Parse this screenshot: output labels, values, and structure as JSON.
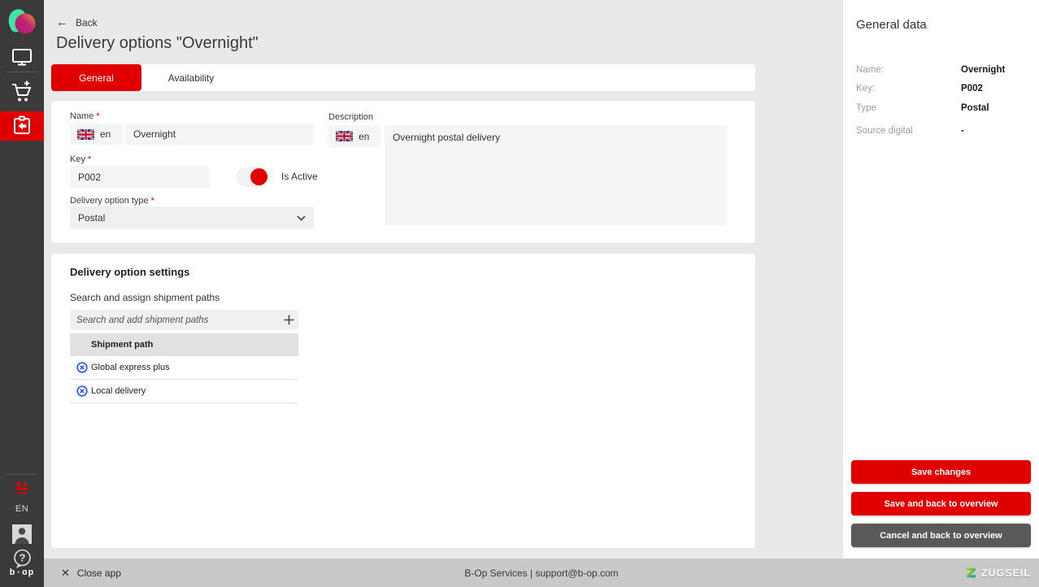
{
  "sidebar": {
    "language_badge": "EN"
  },
  "header": {
    "back_label": "Back",
    "title": "Delivery options \"Overnight\""
  },
  "tabs": {
    "general": "General",
    "availability": "Availability"
  },
  "form": {
    "required_marker": "*",
    "name_label": "Name",
    "name_lang": "en",
    "name_value": "Overnight",
    "key_label": "Key",
    "key_value": "P002",
    "is_active_label": "Is Active",
    "type_label": "Delivery option type",
    "type_value": "Postal",
    "description_label": "Description",
    "description_lang": "en",
    "description_value": "Overnight postal delivery"
  },
  "settings": {
    "title": "Delivery option settings",
    "search_label": "Search and assign shipment paths",
    "search_placeholder": "Search and add shipment paths",
    "table_header": "Shipment path",
    "rows": [
      {
        "label": "Global express plus"
      },
      {
        "label": "Local delivery"
      }
    ]
  },
  "summary": {
    "title": "General data",
    "rows": [
      {
        "label": "Name:",
        "value": "Overnight"
      },
      {
        "label": "Key:",
        "value": "P002"
      },
      {
        "label": "Type",
        "value": "Postal"
      },
      {
        "label": "Source digital",
        "value": "-"
      }
    ],
    "buttons": {
      "save": "Save changes",
      "save_back": "Save and back to overview",
      "cancel_back": "Cancel and back to overview"
    }
  },
  "footer": {
    "close_label": "Close app",
    "support_text": "B-Op Services | support@b-op.com",
    "brand": "ZUGSEIL"
  },
  "colors": {
    "accent_red": "#e10000",
    "sidebar_bg": "#3a3a3a",
    "page_bg": "#e9e9e9",
    "footer_bg": "#c9c9c9",
    "input_bg": "#f5f5f5",
    "table_header_bg": "#e1e1e1",
    "remove_icon_blue": "#2b5ce0",
    "secondary_button_gray": "#595959",
    "brand_green": "#00a19a"
  }
}
